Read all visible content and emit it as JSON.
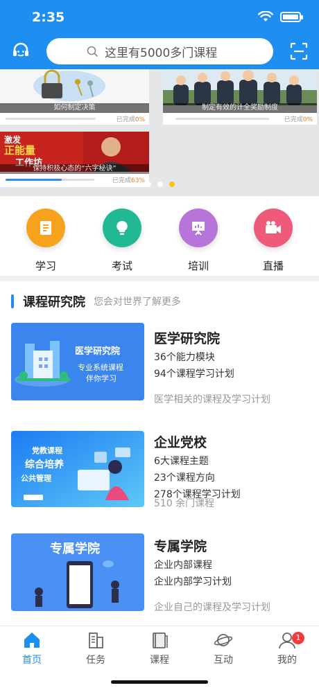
{
  "status": {
    "time": "2:35"
  },
  "header": {
    "search_placeholder": "这里有5000多门课程"
  },
  "banner": {
    "cards": [
      {
        "caption": "如何制定决策",
        "done_label": "已完成",
        "done_value": "0%",
        "progress": 0
      },
      {
        "caption": "制定有效的计全奖励制度",
        "done_label": "已完成",
        "done_value": "0%",
        "progress": 0
      },
      {
        "caption": "保持积极心态的“六字秘诀”",
        "done_label": "已完成",
        "done_value": "63%",
        "progress": 0.63,
        "poster_text": [
          "激发",
          "正能量",
          "工作坊"
        ]
      }
    ],
    "active_dot": 2
  },
  "quick": [
    {
      "label": "学习",
      "color": "#f7a21c",
      "icon": "study-icon"
    },
    {
      "label": "考试",
      "color": "#22b894",
      "icon": "bulb-icon"
    },
    {
      "label": "培训",
      "color": "#b774d9",
      "icon": "presentation-icon"
    },
    {
      "label": "直播",
      "color": "#f05a7a",
      "icon": "video-camera-icon"
    }
  ],
  "section": {
    "title": "课程研究院",
    "subtitle": "您会对世界了解更多"
  },
  "courses": [
    {
      "name": "医学研究院",
      "lines": [
        "36个能力模块",
        "94个课程学习计划"
      ],
      "note": "医学相关的课程及学习计划",
      "img_title": "医学研究院",
      "img_sub1": "专业系统课程",
      "img_sub2": "伴你学习"
    },
    {
      "name": "企业党校",
      "lines": [
        "6大课程主题",
        "23个课程方向",
        "278个课程学习计划"
      ],
      "note": "510 余门课程",
      "img_title1": "党教课程",
      "img_title2": "综合培养",
      "img_title3": "公共管理"
    },
    {
      "name": "专属学院",
      "lines": [
        "企业内部课程",
        "企业内部学习计划"
      ],
      "note": "企业自己的课程及学习计划",
      "img_title": "专属学院"
    }
  ],
  "tabs": [
    {
      "label": "首页",
      "icon": "home-icon",
      "active": true
    },
    {
      "label": "任务",
      "icon": "building-icon"
    },
    {
      "label": "课程",
      "icon": "book-icon"
    },
    {
      "label": "互动",
      "icon": "planet-icon"
    },
    {
      "label": "我的",
      "icon": "user-icon",
      "badge": "1"
    }
  ],
  "colors": {
    "primary": "#1f8ef1",
    "badge": "#f23c3c"
  }
}
